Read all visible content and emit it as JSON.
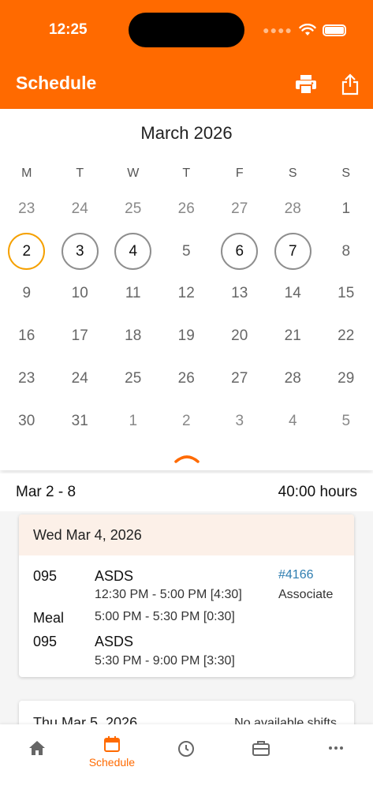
{
  "status": {
    "time": "12:25"
  },
  "header": {
    "title": "Schedule"
  },
  "calendar": {
    "month_label": "March 2026",
    "weekdays": [
      "M",
      "T",
      "W",
      "T",
      "F",
      "S",
      "S"
    ],
    "days": [
      {
        "n": "23",
        "t": "muted"
      },
      {
        "n": "24",
        "t": "muted"
      },
      {
        "n": "25",
        "t": "muted"
      },
      {
        "n": "26",
        "t": "muted"
      },
      {
        "n": "27",
        "t": "muted"
      },
      {
        "n": "28",
        "t": "muted"
      },
      {
        "n": "1",
        "t": "normal"
      },
      {
        "n": "2",
        "t": "today"
      },
      {
        "n": "3",
        "t": "shift"
      },
      {
        "n": "4",
        "t": "shift"
      },
      {
        "n": "5",
        "t": "normal"
      },
      {
        "n": "6",
        "t": "shift"
      },
      {
        "n": "7",
        "t": "shift"
      },
      {
        "n": "8",
        "t": "normal"
      },
      {
        "n": "9",
        "t": "normal"
      },
      {
        "n": "10",
        "t": "normal"
      },
      {
        "n": "11",
        "t": "normal"
      },
      {
        "n": "12",
        "t": "normal"
      },
      {
        "n": "13",
        "t": "normal"
      },
      {
        "n": "14",
        "t": "normal"
      },
      {
        "n": "15",
        "t": "normal"
      },
      {
        "n": "16",
        "t": "normal"
      },
      {
        "n": "17",
        "t": "normal"
      },
      {
        "n": "18",
        "t": "normal"
      },
      {
        "n": "19",
        "t": "normal"
      },
      {
        "n": "20",
        "t": "normal"
      },
      {
        "n": "21",
        "t": "normal"
      },
      {
        "n": "22",
        "t": "normal"
      },
      {
        "n": "23",
        "t": "normal"
      },
      {
        "n": "24",
        "t": "normal"
      },
      {
        "n": "25",
        "t": "normal"
      },
      {
        "n": "26",
        "t": "normal"
      },
      {
        "n": "27",
        "t": "normal"
      },
      {
        "n": "28",
        "t": "normal"
      },
      {
        "n": "29",
        "t": "normal"
      },
      {
        "n": "30",
        "t": "normal"
      },
      {
        "n": "31",
        "t": "normal"
      },
      {
        "n": "1",
        "t": "muted"
      },
      {
        "n": "2",
        "t": "muted"
      },
      {
        "n": "3",
        "t": "muted"
      },
      {
        "n": "4",
        "t": "muted"
      },
      {
        "n": "5",
        "t": "muted"
      }
    ]
  },
  "week": {
    "range": "Mar 2 - 8",
    "hours": "40:00 hours"
  },
  "cards": [
    {
      "date": "Wed Mar 4, 2026",
      "shift1": {
        "code": "095",
        "role": "ASDS",
        "time": "12:30 PM - 5:00 PM [4:30]",
        "ticket": "#4166",
        "position": "Associate"
      },
      "meal": {
        "label": "Meal",
        "time": "5:00 PM - 5:30 PM [0:30]"
      },
      "shift2": {
        "code": "095",
        "role": "ASDS",
        "time": "5:30 PM - 9:00 PM [3:30]"
      }
    },
    {
      "date": "Thu Mar 5, 2026",
      "note": "No available shifts"
    }
  ],
  "tabs": {
    "schedule_label": "Schedule"
  },
  "colors": {
    "accent": "#FF6A00",
    "today_ring": "#F5A000",
    "shift_ring": "#8E8E8E",
    "link": "#2E7DB0"
  }
}
